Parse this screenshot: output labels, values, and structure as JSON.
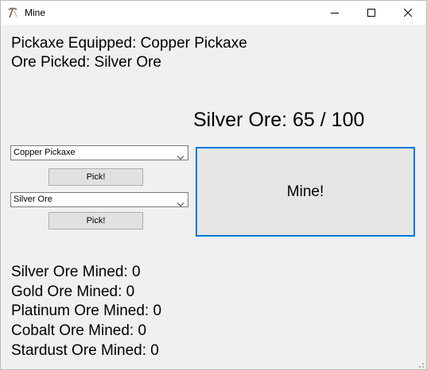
{
  "window": {
    "title": "Mine"
  },
  "status": {
    "pickaxe_equipped": "Pickaxe Equipped: Copper Pickaxe",
    "ore_picked": "Ore Picked: Silver Ore"
  },
  "progress": {
    "label": "Silver Ore: 65 / 100",
    "current": 65,
    "target": 100
  },
  "pickaxe_select": {
    "selected": "Copper Pickaxe",
    "button_label": "Pick!"
  },
  "ore_select": {
    "selected": "Silver Ore",
    "button_label": "Pick!"
  },
  "mine_button": {
    "label": "Mine!"
  },
  "stats": [
    {
      "label": "Silver Ore Mined: 0"
    },
    {
      "label": "Gold Ore Mined: 0"
    },
    {
      "label": "Platinum Ore Mined: 0"
    },
    {
      "label": "Cobalt Ore Mined: 0"
    },
    {
      "label": "Stardust Ore Mined: 0"
    }
  ],
  "icons": {
    "app": "pickaxe-icon",
    "minimize": "minimize-icon",
    "maximize": "maximize-icon",
    "close": "close-icon",
    "dropdown": "chevron-down-icon"
  },
  "colors": {
    "window_bg": "#f0f0f0",
    "titlebar_bg": "#ffffff",
    "focus_border": "#0078d7",
    "button_bg": "#e1e1e1"
  }
}
